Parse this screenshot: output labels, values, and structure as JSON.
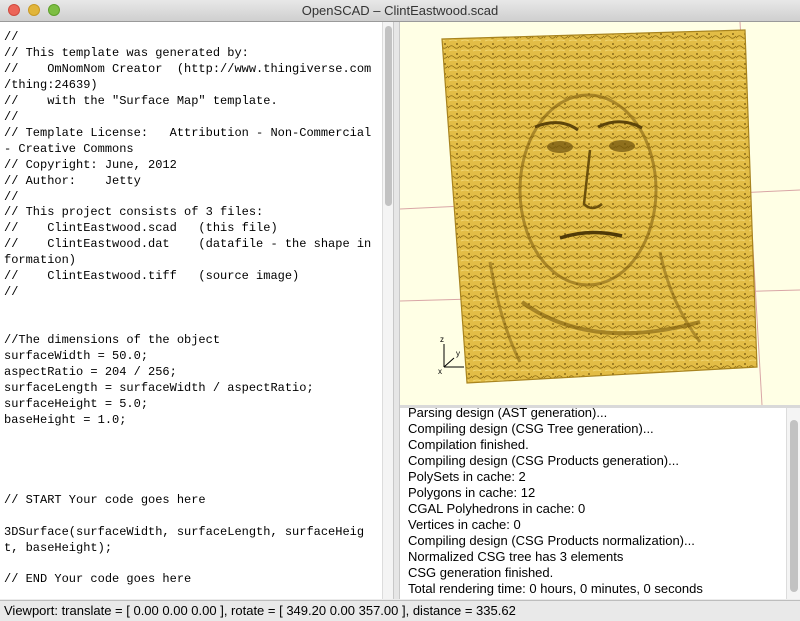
{
  "window": {
    "title": "OpenSCAD – ClintEastwood.scad"
  },
  "editor": {
    "code": "//\n// This template was generated by:\n//    OmNomNom Creator  (http://www.thingiverse.com\n/thing:24639)\n//    with the \"Surface Map\" template.\n//\n// Template License:   Attribution - Non-Commercial\n- Creative Commons\n// Copyright: June, 2012\n// Author:    Jetty\n//\n// This project consists of 3 files:\n//    ClintEastwood.scad   (this file)\n//    ClintEastwood.dat    (datafile - the shape in\nformation)\n//    ClintEastwood.tiff   (source image)\n//\n\n\n//The dimensions of the object\nsurfaceWidth = 50.0;\naspectRatio = 204 / 256;\nsurfaceLength = surfaceWidth / aspectRatio;\nsurfaceHeight = 5.0;\nbaseHeight = 1.0;\n\n\n\n\n// START Your code goes here\n\n3DSurface(surfaceWidth, surfaceLength, surfaceHeig\nt, baseHeight);\n\n// END Your code goes here"
  },
  "viewport": {
    "axis_x": "x",
    "axis_y": "y",
    "axis_z": "z",
    "background_color": "#ffffe5",
    "surface_color": "#e8c34a"
  },
  "console": {
    "lines": [
      "Parsing design (AST generation)...",
      "Compiling design (CSG Tree generation)...",
      "Compilation finished.",
      "Compiling design (CSG Products generation)...",
      "PolySets in cache: 2",
      "Polygons in cache: 12",
      "CGAL Polyhedrons in cache: 0",
      "Vertices in cache: 0",
      "Compiling design (CSG Products normalization)...",
      "Normalized CSG tree has 3 elements",
      "CSG generation finished.",
      "Total rendering time: 0 hours, 0 minutes, 0 seconds"
    ]
  },
  "status": {
    "text": "Viewport: translate = [ 0.00 0.00 0.00 ], rotate = [ 349.20 0.00 357.00 ], distance = 335.62"
  }
}
